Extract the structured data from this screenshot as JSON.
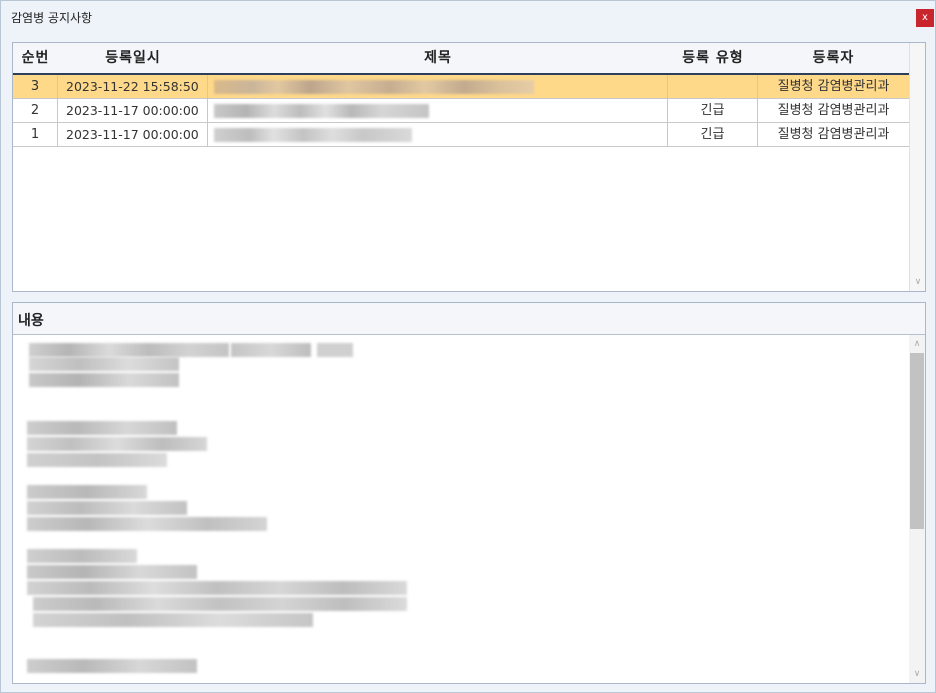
{
  "window": {
    "title": "감염병 공지사항",
    "close_label": "x"
  },
  "grid": {
    "columns": [
      "순번",
      "등록일시",
      "제목",
      "등록 유형",
      "등록자"
    ],
    "rows": [
      {
        "no": "3",
        "date": "2023-11-22 15:58:50",
        "type": "",
        "registrant": "질병청 감염병관리과",
        "selected": true
      },
      {
        "no": "2",
        "date": "2023-11-17 00:00:00",
        "type": "긴급",
        "registrant": "질병청 감염병관리과",
        "selected": false
      },
      {
        "no": "1",
        "date": "2023-11-17 00:00:00",
        "type": "긴급",
        "registrant": "질병청 감염병관리과",
        "selected": false
      }
    ]
  },
  "content": {
    "header": "내용"
  },
  "icons": {
    "close": "close-icon",
    "scroll_up": "chevron-up-icon",
    "scroll_down": "chevron-down-icon"
  },
  "colors": {
    "selected_row": "#ffd98a",
    "close_button": "#c8252c",
    "header_rule": "#2d3f5c"
  }
}
